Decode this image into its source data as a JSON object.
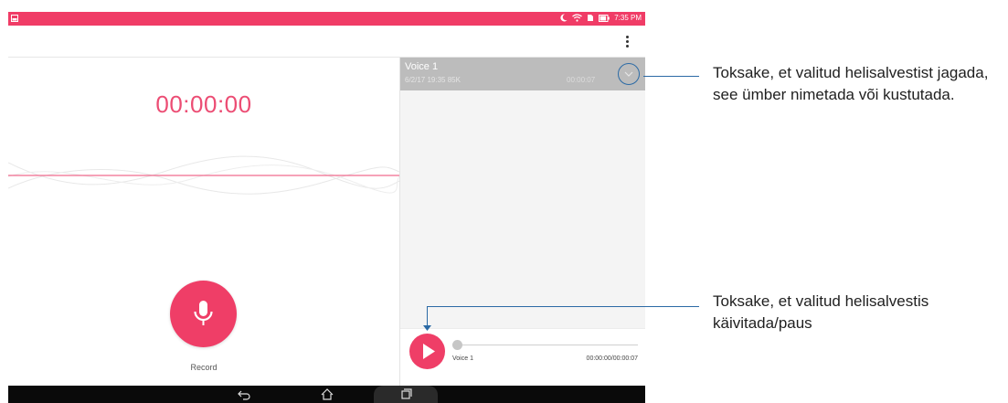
{
  "status_bar": {
    "time": "7:35 PM",
    "icons": [
      "notification-icon",
      "moon-icon",
      "wifi-icon",
      "battery-icon"
    ]
  },
  "app_bar": {
    "menu_icon": "more-vert-icon"
  },
  "recorder": {
    "timer": "00:00:00",
    "record_label": "Record",
    "accent_color": "#ef3e67"
  },
  "recordings": [
    {
      "name": "Voice 1",
      "meta": "6/2/17 19:35  85K",
      "duration": "00:00:07"
    }
  ],
  "player": {
    "name": "Voice 1",
    "time": "00:00:00/00:00:07",
    "progress": 0
  },
  "callouts": {
    "top": "Toksake, et valitud helisalvestist jagada, see ümber nimetada või kustutada.",
    "bottom": "Toksake, et valitud helisalvestis käivitada/paus"
  }
}
